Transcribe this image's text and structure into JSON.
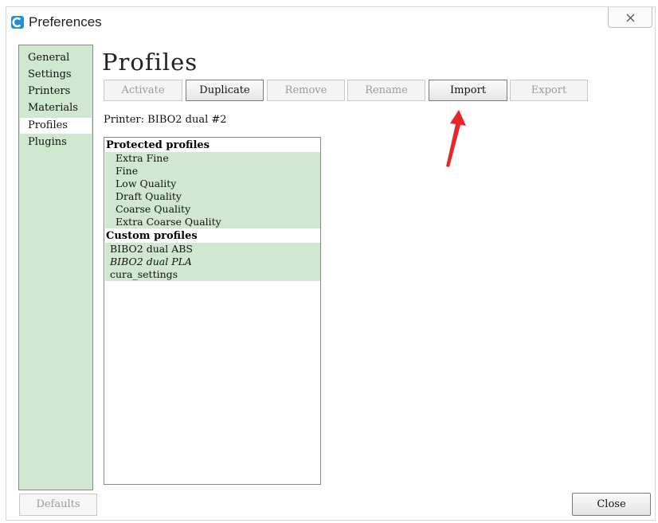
{
  "window": {
    "title": "Preferences"
  },
  "sidebar": {
    "items": [
      {
        "label": "General"
      },
      {
        "label": "Settings"
      },
      {
        "label": "Printers"
      },
      {
        "label": "Materials"
      },
      {
        "label": "Profiles",
        "selected": true
      },
      {
        "label": "Plugins"
      }
    ]
  },
  "main": {
    "heading": "Profiles",
    "buttons": [
      {
        "label": "Activate",
        "enabled": false
      },
      {
        "label": "Duplicate",
        "enabled": true
      },
      {
        "label": "Remove",
        "enabled": false
      },
      {
        "label": "Rename",
        "enabled": false
      },
      {
        "label": "Import",
        "enabled": true
      },
      {
        "label": "Export",
        "enabled": false
      }
    ],
    "printer_label": "Printer: BIBO2 dual #2",
    "profiles": {
      "protected_header": "Protected profiles",
      "protected": [
        "Extra Fine",
        "Fine",
        "Low Quality",
        "Draft Quality",
        "Coarse Quality",
        "Extra Coarse Quality"
      ],
      "custom_header": "Custom profiles",
      "custom": [
        "BIBO2 dual ABS",
        "BIBO2 dual PLA",
        "cura_settings"
      ]
    }
  },
  "footer": {
    "defaults_label": "Defaults",
    "close_label": "Close"
  },
  "colors": {
    "selection_green": "#cfe8cf",
    "annotation_arrow": "#e8262a",
    "app_icon": "#1f8fd6"
  },
  "icons": {
    "app": "cura-logo-icon",
    "close": "close-x-icon",
    "annotation": "red-arrow-icon"
  }
}
